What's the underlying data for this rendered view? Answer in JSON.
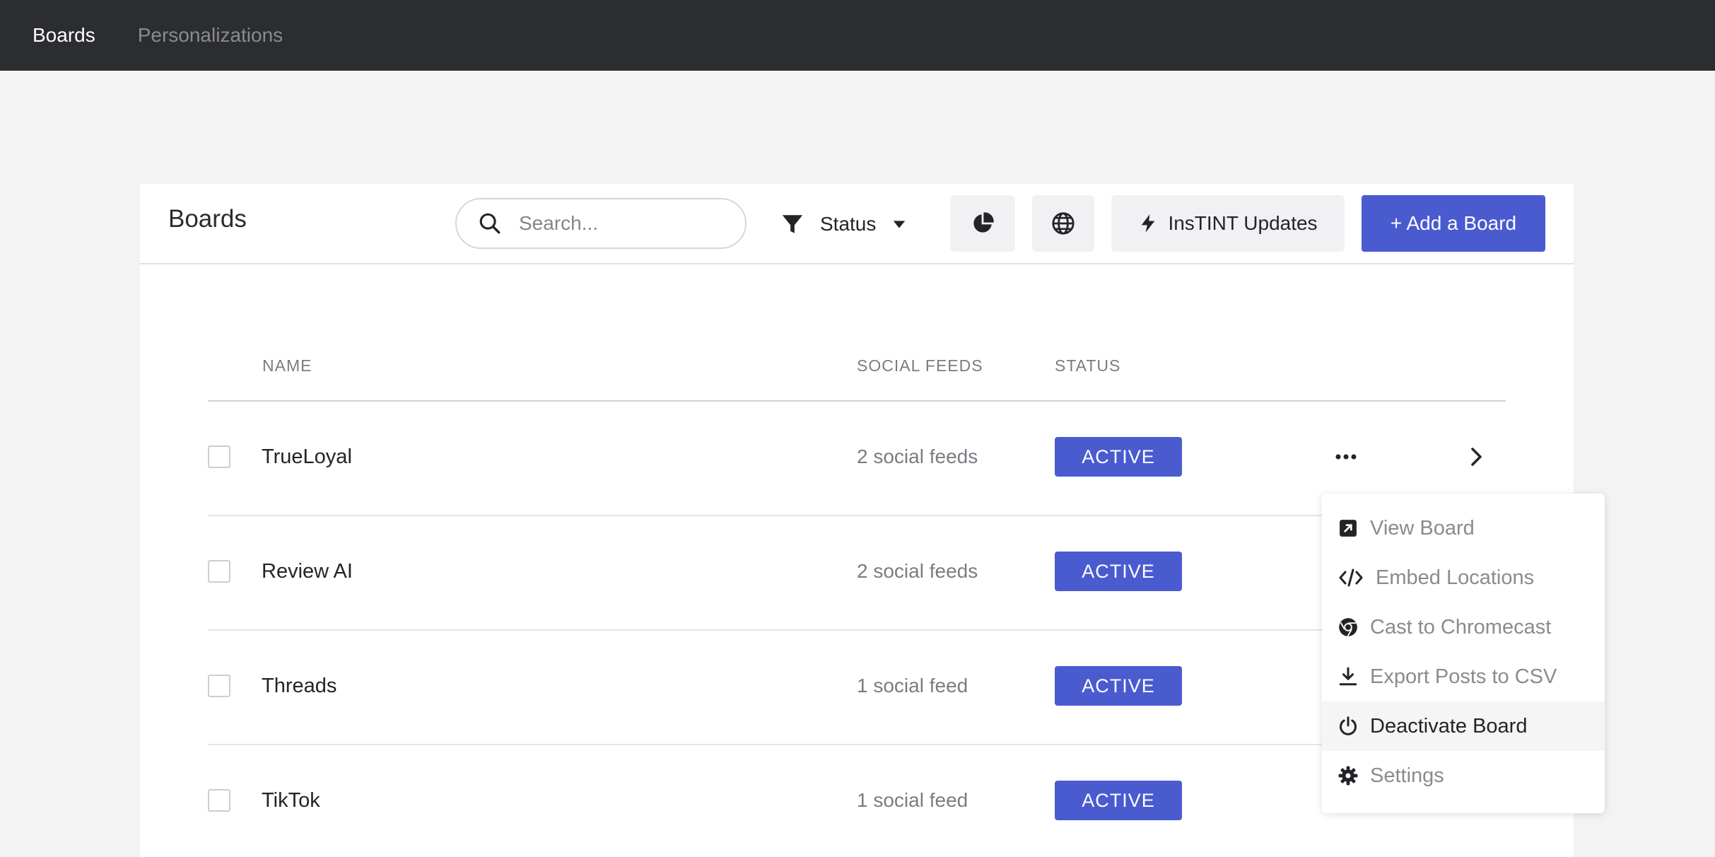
{
  "topnav": {
    "items": [
      {
        "label": "Boards",
        "active": true
      },
      {
        "label": "Personalizations",
        "active": false
      }
    ]
  },
  "header": {
    "title": "Boards",
    "search_placeholder": "Search...",
    "status_filter_label": "Status",
    "updates_label": "InsTINT Updates",
    "add_button_label": "+ Add a Board",
    "icons": [
      "search-icon",
      "filter-icon",
      "chevron-down-icon",
      "pie-chart-icon",
      "globe-icon",
      "bolt-icon"
    ]
  },
  "table": {
    "columns": [
      "NAME",
      "SOCIAL FEEDS",
      "STATUS"
    ],
    "rows": [
      {
        "name": "TrueLoyal",
        "feeds": "2 social feeds",
        "status": "ACTIVE"
      },
      {
        "name": "Review AI",
        "feeds": "2 social feeds",
        "status": "ACTIVE"
      },
      {
        "name": "Threads",
        "feeds": "1 social feed",
        "status": "ACTIVE"
      },
      {
        "name": "TikTok",
        "feeds": "1 social feed",
        "status": "ACTIVE"
      }
    ]
  },
  "menu": {
    "items": [
      {
        "label": "View Board",
        "icon": "external-link-icon"
      },
      {
        "label": "Embed Locations",
        "icon": "code-icon"
      },
      {
        "label": "Cast to Chromecast",
        "icon": "chrome-icon"
      },
      {
        "label": "Export Posts to CSV",
        "icon": "download-icon"
      },
      {
        "label": "Deactivate Board",
        "icon": "power-icon"
      },
      {
        "label": "Settings",
        "icon": "gear-icon"
      }
    ]
  },
  "colors": {
    "topnav_bg": "#2c2d31",
    "page_bg": "#f3f3f3",
    "accent": "#4a5bd0",
    "muted_text": "#7b7c82"
  }
}
